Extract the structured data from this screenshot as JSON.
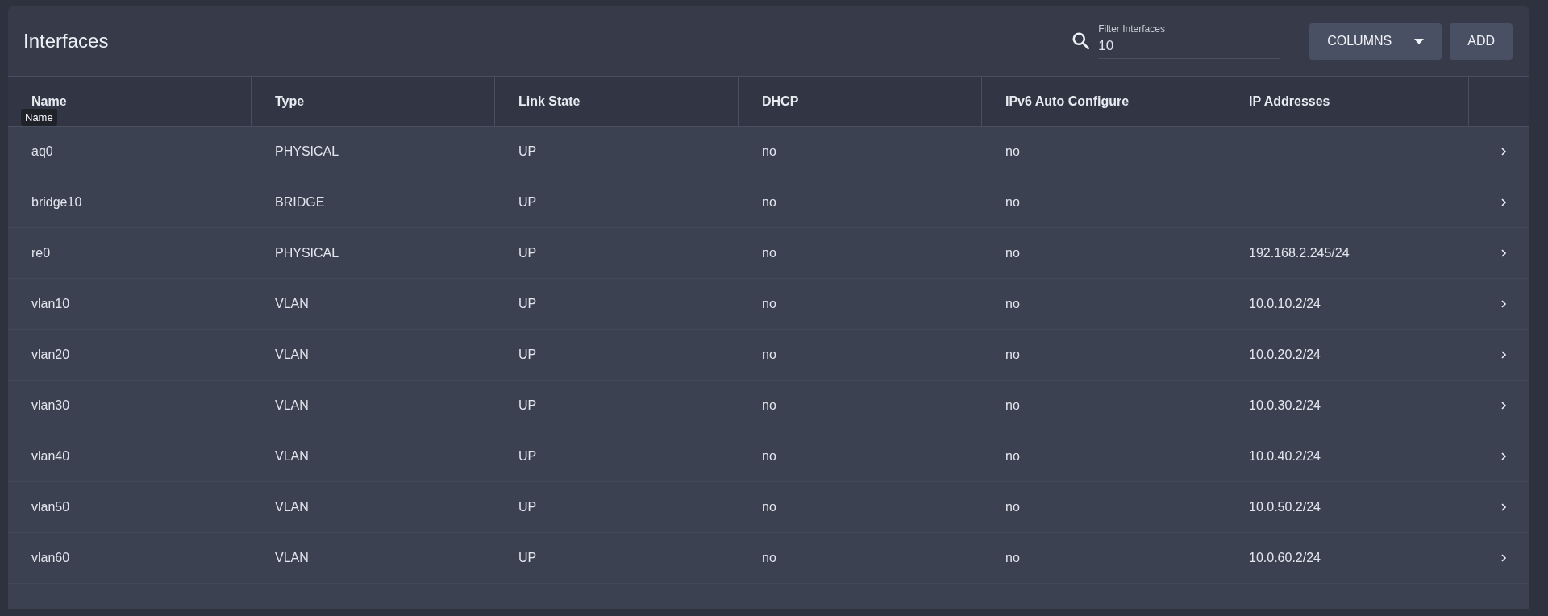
{
  "title": "Interfaces",
  "filter": {
    "label": "Filter Interfaces",
    "value": "10"
  },
  "buttons": [
    {
      "label": "COLUMNS",
      "kind": "dropdown"
    },
    {
      "label": "ADD",
      "kind": "plain"
    }
  ],
  "table": {
    "columns": [
      "Name",
      "Type",
      "Link State",
      "DHCP",
      "IPv6 Auto Configure",
      "IP Addresses"
    ],
    "tooltip": "Name",
    "rows": [
      [
        "aq0",
        "PHYSICAL",
        "UP",
        "no",
        "no",
        ""
      ],
      [
        "bridge10",
        "BRIDGE",
        "UP",
        "no",
        "no",
        ""
      ],
      [
        "re0",
        "PHYSICAL",
        "UP",
        "no",
        "no",
        "192.168.2.245/24"
      ],
      [
        "vlan10",
        "VLAN",
        "UP",
        "no",
        "no",
        "10.0.10.2/24"
      ],
      [
        "vlan20",
        "VLAN",
        "UP",
        "no",
        "no",
        "10.0.20.2/24"
      ],
      [
        "vlan30",
        "VLAN",
        "UP",
        "no",
        "no",
        "10.0.30.2/24"
      ],
      [
        "vlan40",
        "VLAN",
        "UP",
        "no",
        "no",
        "10.0.40.2/24"
      ],
      [
        "vlan50",
        "VLAN",
        "UP",
        "no",
        "no",
        "10.0.50.2/24"
      ],
      [
        "vlan60",
        "VLAN",
        "UP",
        "no",
        "no",
        "10.0.60.2/24"
      ]
    ]
  }
}
